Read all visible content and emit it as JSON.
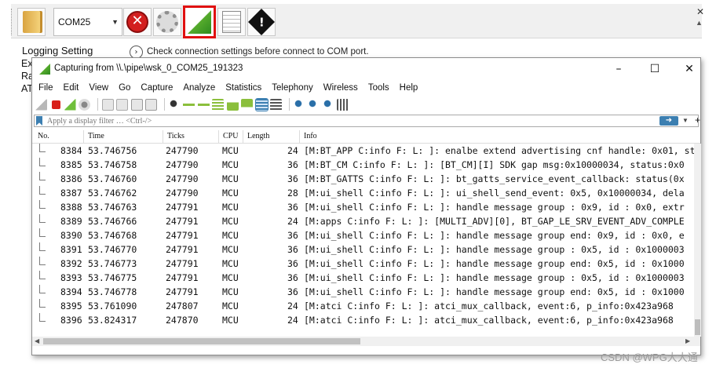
{
  "outer_app": {
    "com_port": "COM25",
    "logging_setting": "Logging Setting",
    "hint": "Check connection settings before connect to COM port.",
    "side_labels": [
      "Ex",
      "Ra",
      "AT"
    ]
  },
  "window": {
    "title": "Capturing from \\\\.\\pipe\\wsk_0_COM25_191323"
  },
  "menu": [
    "File",
    "Edit",
    "View",
    "Go",
    "Capture",
    "Analyze",
    "Statistics",
    "Telephony",
    "Wireless",
    "Tools",
    "Help"
  ],
  "filter": {
    "placeholder": "Apply a display filter … <Ctrl-/>"
  },
  "columns": [
    "No.",
    "Time",
    "Ticks",
    "CPU",
    "Length",
    "Info"
  ],
  "rows": [
    {
      "no": "8384",
      "time": "53.746756",
      "ticks": "247790",
      "cpu": "MCU",
      "length": "24",
      "info": "[M:BT_APP C:info F: L: ]: enalbe extend advertising cnf handle: 0x01, st"
    },
    {
      "no": "8385",
      "time": "53.746758",
      "ticks": "247790",
      "cpu": "MCU",
      "length": "36",
      "info": "[M:BT_CM C:info F: L: ]: [BT_CM][I] SDK gap msg:0x10000034, status:0x0"
    },
    {
      "no": "8386",
      "time": "53.746760",
      "ticks": "247790",
      "cpu": "MCU",
      "length": "36",
      "info": "[M:BT_GATTS C:info F: L: ]: bt_gatts_service_event_callback: status(0x"
    },
    {
      "no": "8387",
      "time": "53.746762",
      "ticks": "247790",
      "cpu": "MCU",
      "length": "28",
      "info": "[M:ui_shell C:info F: L: ]: ui_shell_send_event: 0x5, 0x10000034, dela"
    },
    {
      "no": "8388",
      "time": "53.746763",
      "ticks": "247791",
      "cpu": "MCU",
      "length": "36",
      "info": "[M:ui_shell C:info F: L: ]: handle message group : 0x9, id : 0x0, extr"
    },
    {
      "no": "8389",
      "time": "53.746766",
      "ticks": "247791",
      "cpu": "MCU",
      "length": "24",
      "info": "[M:apps C:info F: L: ]: [MULTI_ADV][0], BT_GAP_LE_SRV_EVENT_ADV_COMPLE"
    },
    {
      "no": "8390",
      "time": "53.746768",
      "ticks": "247791",
      "cpu": "MCU",
      "length": "36",
      "info": "[M:ui_shell C:info F: L: ]: handle message group end: 0x9, id : 0x0, e"
    },
    {
      "no": "8391",
      "time": "53.746770",
      "ticks": "247791",
      "cpu": "MCU",
      "length": "36",
      "info": "[M:ui_shell C:info F: L: ]: handle message group : 0x5, id : 0x1000003"
    },
    {
      "no": "8392",
      "time": "53.746773",
      "ticks": "247791",
      "cpu": "MCU",
      "length": "36",
      "info": "[M:ui_shell C:info F: L: ]: handle message group end: 0x5, id : 0x1000"
    },
    {
      "no": "8393",
      "time": "53.746775",
      "ticks": "247791",
      "cpu": "MCU",
      "length": "36",
      "info": "[M:ui_shell C:info F: L: ]: handle message group : 0x5, id : 0x1000003"
    },
    {
      "no": "8394",
      "time": "53.746778",
      "ticks": "247791",
      "cpu": "MCU",
      "length": "36",
      "info": "[M:ui_shell C:info F: L: ]: handle message group end: 0x5, id : 0x1000"
    },
    {
      "no": "8395",
      "time": "53.761090",
      "ticks": "247807",
      "cpu": "MCU",
      "length": "24",
      "info": "[M:atci C:info F: L: ]: atci_mux_callback, event:6, p_info:0x423a968"
    },
    {
      "no": "8396",
      "time": "53.824317",
      "ticks": "247870",
      "cpu": "MCU",
      "length": "24",
      "info": "[M:atci C:info F: L: ]: atci_mux_callback, event:6, p_info:0x423a968"
    }
  ],
  "watermark": "CSDN @WPG大大通",
  "colors": {
    "highlight": "#e01010",
    "accent": "#3c7fb1"
  }
}
